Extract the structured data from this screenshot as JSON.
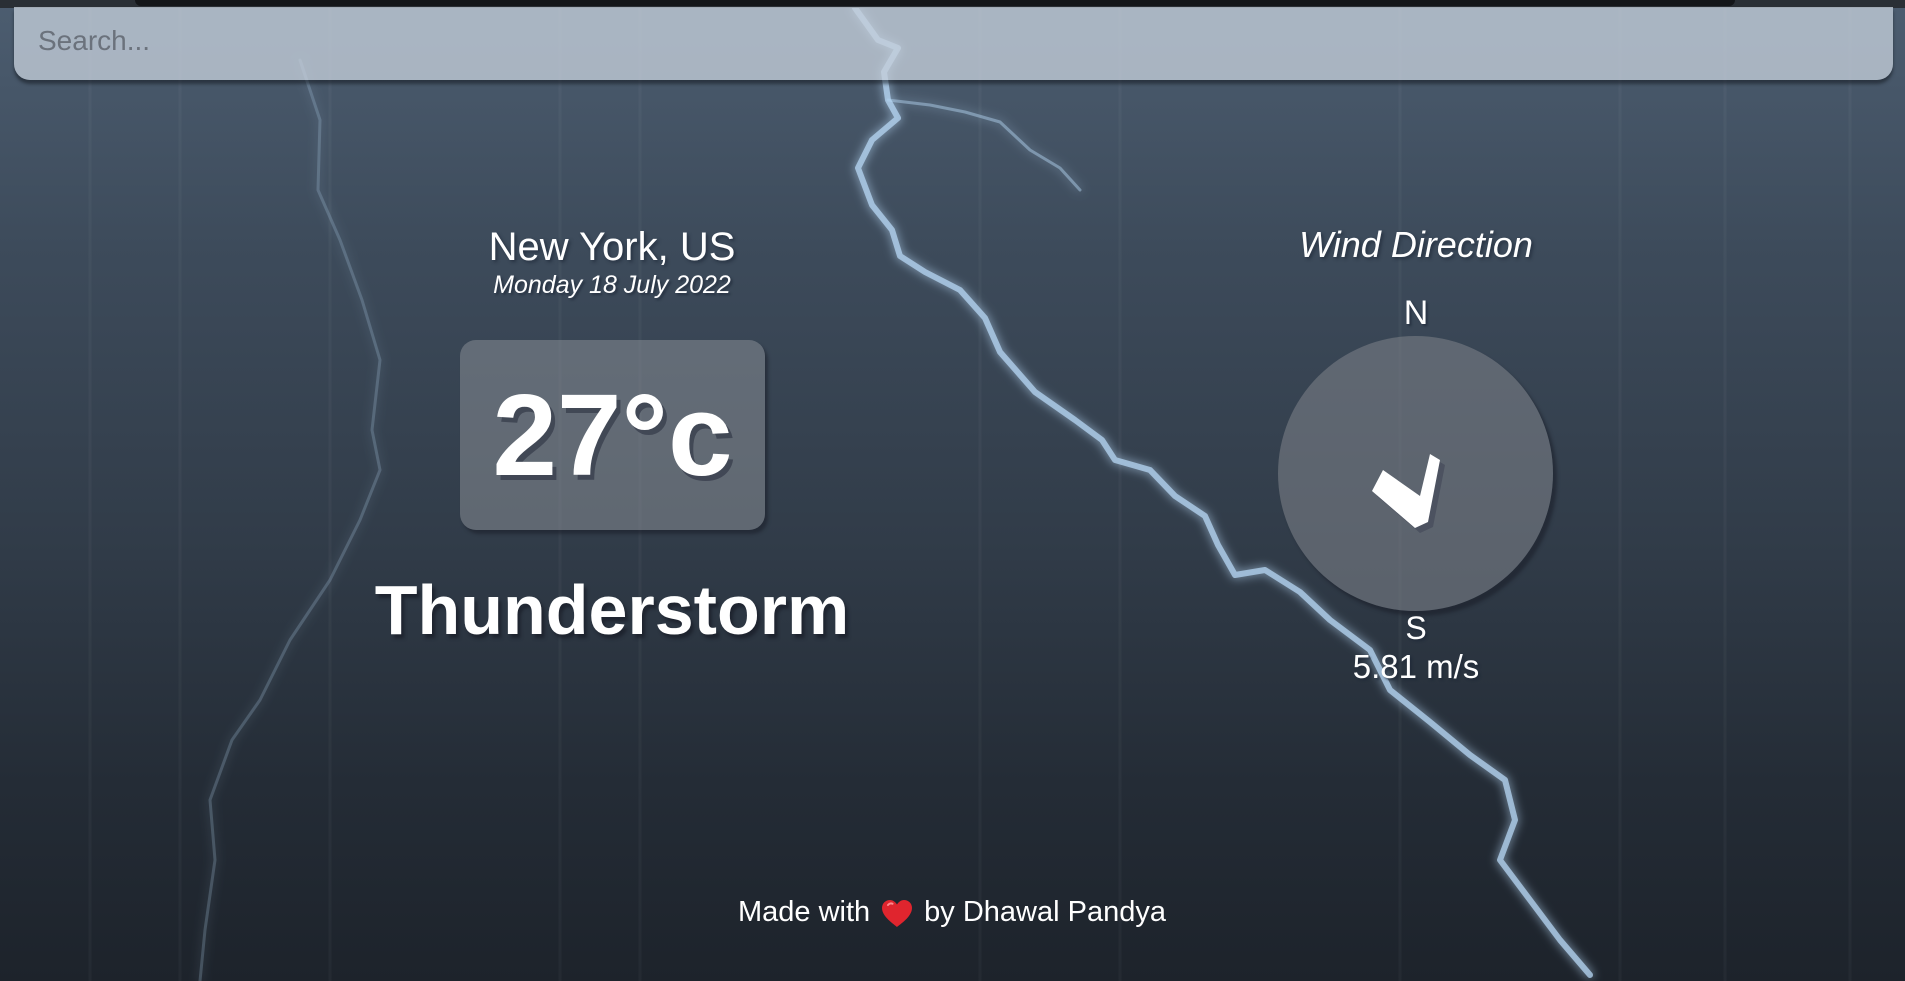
{
  "search": {
    "placeholder": "Search..."
  },
  "location": {
    "city": "New York, US",
    "date": "Monday 18 July 2022"
  },
  "weather": {
    "temperature": "27°c",
    "condition": "Thunderstorm"
  },
  "wind": {
    "title": "Wind Direction",
    "north_label": "N",
    "south_label": "S",
    "speed": "5.81 m/s",
    "direction_icon": "arrow-down-icon"
  },
  "footer": {
    "prefix": "Made with",
    "icon": "heart-icon",
    "suffix": "by Dhawal Pandya"
  },
  "colors": {
    "background_top": "#4c5d70",
    "background_bottom": "#1d232b",
    "search_bar": "#c4ceda",
    "heart": "#e0252e",
    "lightning": "#b6d6f3"
  }
}
